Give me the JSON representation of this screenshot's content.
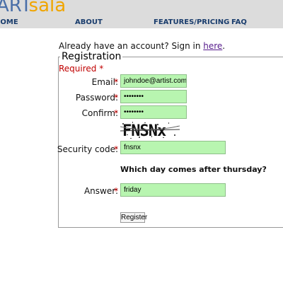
{
  "brand": {
    "part1": "ART",
    "part2": "sala"
  },
  "nav": [
    {
      "label": "HOME"
    },
    {
      "label": "ABOUT"
    },
    {
      "label": "FEATURES/PRICING"
    },
    {
      "label": "FAQ"
    }
  ],
  "account": {
    "prefix": "Already have an account? Sign in ",
    "link": "here",
    "suffix": "."
  },
  "form": {
    "legend": "Registration",
    "required_note": "Required",
    "required_mark": "*",
    "email": {
      "label": "Email:",
      "value": "johndoe@artist.com"
    },
    "password": {
      "label": "Password:",
      "value": "••••••••"
    },
    "confirm": {
      "label": "Confirm:",
      "value": "••••••••"
    },
    "captcha_text": "FNSNx",
    "security": {
      "label": "Security code:",
      "value": "fnsnx"
    },
    "question": "Which day comes after thursday?",
    "answer": {
      "label": "Answer:",
      "value": "friday"
    },
    "submit": "Register"
  }
}
